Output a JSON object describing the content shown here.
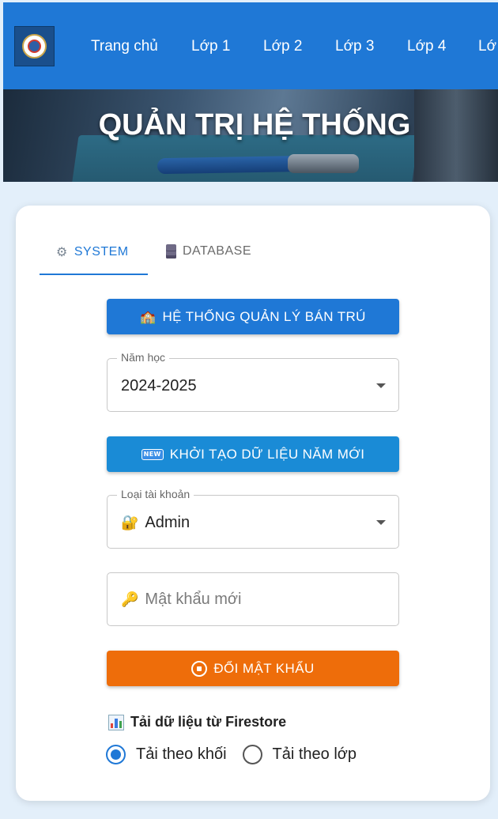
{
  "nav": {
    "items": [
      "Trang chủ",
      "Lớp 1",
      "Lớp 2",
      "Lớp 3",
      "Lớp 4",
      "Lớ"
    ]
  },
  "banner": {
    "title": "QUẢN TRỊ HỆ THỐNG"
  },
  "tabs": [
    {
      "label": "SYSTEM",
      "icon": "gear-icon",
      "active": true
    },
    {
      "label": "DATABASE",
      "icon": "database-icon",
      "active": false
    }
  ],
  "buttons": {
    "boarding_label": "HỆ THỐNG QUẢN LÝ BÁN TRÚ",
    "init_label": "KHỞI TẠO DỮ LIỆU NĂM MỚI",
    "change_password_label": "ĐỔI MẬT KHẨU"
  },
  "school_year": {
    "label": "Năm học",
    "value": "2024-2025"
  },
  "account_type": {
    "label": "Loại tài khoản",
    "value": "Admin",
    "icon": "lock-icon"
  },
  "new_password": {
    "placeholder": "Mật khẩu mới",
    "value": "",
    "icon": "key-icon"
  },
  "firestore": {
    "title": "Tải dữ liệu từ Firestore",
    "icon": "bar-chart-icon",
    "options": [
      {
        "label": "Tải theo khối",
        "checked": true
      },
      {
        "label": "Tải theo lớp",
        "checked": false
      }
    ]
  },
  "colors": {
    "primary": "#1f78d6",
    "accent_blue": "#1a8bd6",
    "orange": "#ee6d0a",
    "background": "#e3effa"
  }
}
